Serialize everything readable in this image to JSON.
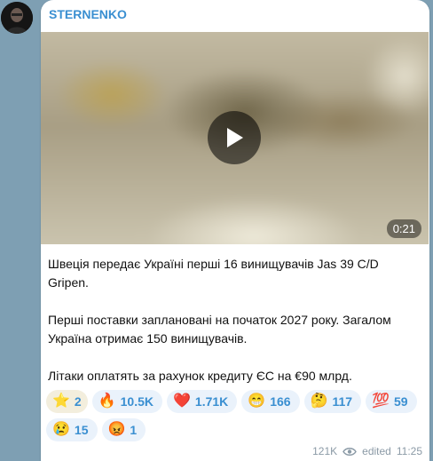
{
  "channel": {
    "name": "STERNENKO",
    "avatar_icon": "avatar-silhouette-icon"
  },
  "media": {
    "duration": "0:21",
    "play_icon": "play-icon"
  },
  "post": {
    "paragraphs": [
      "Швеція передає Україні перші 16 винищувачів Jas 39 C/D Gripen.",
      "Перші поставки заплановані на початок 2027 року. Загалом Україна отримає 150 винищувачів.",
      "Літаки оплатять за рахунок кредиту ЄС на €90 млрд."
    ]
  },
  "reactions": [
    {
      "emoji": "⭐",
      "icon": "star-icon",
      "count": "2"
    },
    {
      "emoji": "🔥",
      "icon": "fire-icon",
      "count": "10.5K"
    },
    {
      "emoji": "❤️",
      "icon": "heart-icon",
      "count": "1.71K"
    },
    {
      "emoji": "😁",
      "icon": "grin-icon",
      "count": "166"
    },
    {
      "emoji": "🤔",
      "icon": "thinking-icon",
      "count": "117"
    },
    {
      "emoji": "💯",
      "icon": "hundred-icon",
      "count": "59"
    },
    {
      "emoji": "😢",
      "icon": "crying-icon",
      "count": "15"
    },
    {
      "emoji": "😡",
      "icon": "angry-icon",
      "count": "1"
    }
  ],
  "footer": {
    "views": "121K",
    "edited": "edited",
    "time": "11:25",
    "views_icon": "eye-icon"
  },
  "colors": {
    "accent": "#3a8fd1",
    "background": "#7e9fb3",
    "meta": "#8b9aa6"
  }
}
